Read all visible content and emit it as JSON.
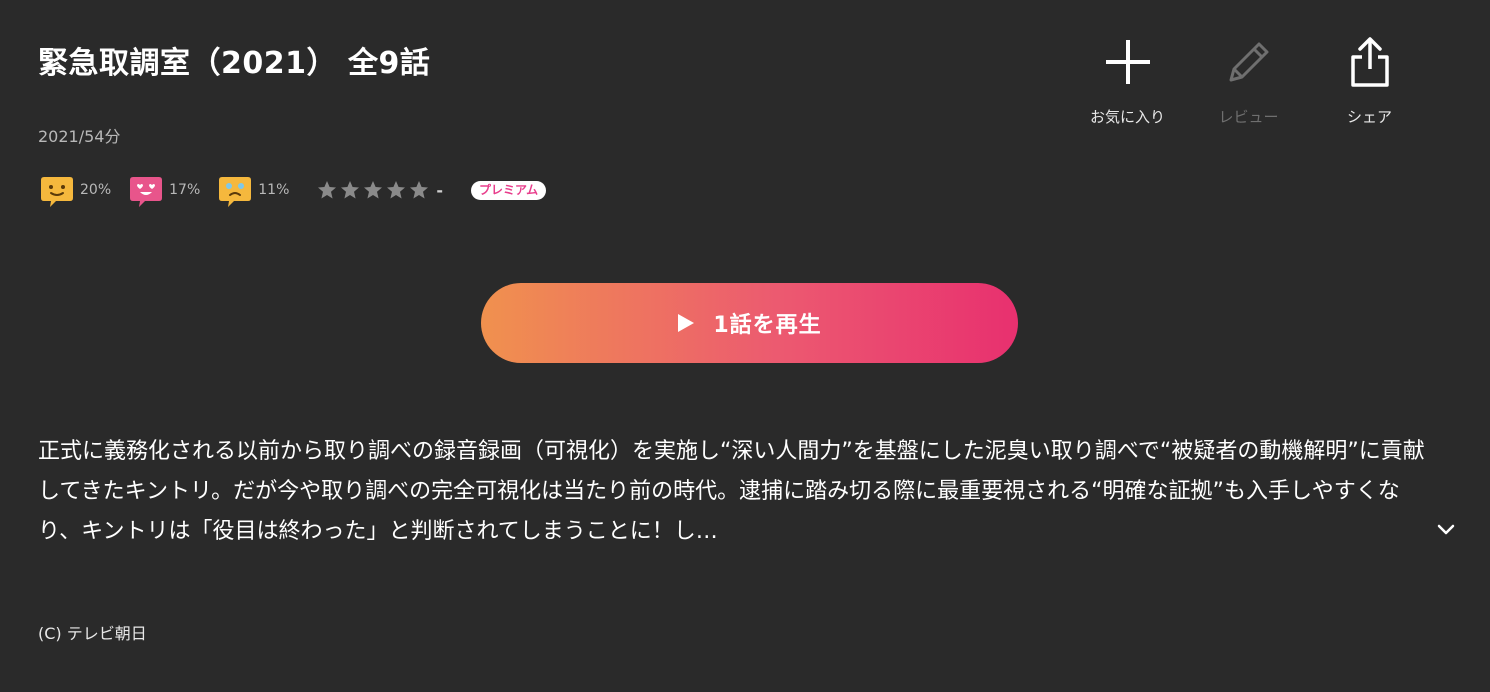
{
  "title": "緊急取調室（2021） 全9話",
  "meta": "2021/54分",
  "actions": {
    "favorite_label": "お気に入り",
    "review_label": "レビュー",
    "share_label": "シェア"
  },
  "reactions": [
    {
      "icon": "smile-face-icon",
      "color": "#f5b83d",
      "label": "20%"
    },
    {
      "icon": "heart-eyes-face-icon",
      "color": "#e8558b",
      "label": "17%"
    },
    {
      "icon": "crying-face-icon",
      "color": "#f5b83d",
      "label": "11%"
    }
  ],
  "rating": {
    "stars": 0,
    "max_stars": 5,
    "value": "-"
  },
  "badge": {
    "label": "プレミアム"
  },
  "play_button": {
    "label": "1話を再生"
  },
  "description": "正式に義務化される以前から取り調べの録音録画（可視化）を実施し“深い人間力”を基盤にした泥臭い取り調べで“被疑者の動機解明”に貢献してきたキントリ。だが今や取り調べの完全可視化は当たり前の時代。逮捕に踏み切る際に最重要視される“明確な証拠”も入手しやすくなり、キントリは「役目は終わった」と判断されてしまうことに！し…",
  "copyright": "(C) テレビ朝日",
  "colors": {
    "background": "#2a2a2a",
    "gradient_start": "#f0914e",
    "gradient_end": "#e8306f",
    "premium": "#e83e8c"
  }
}
